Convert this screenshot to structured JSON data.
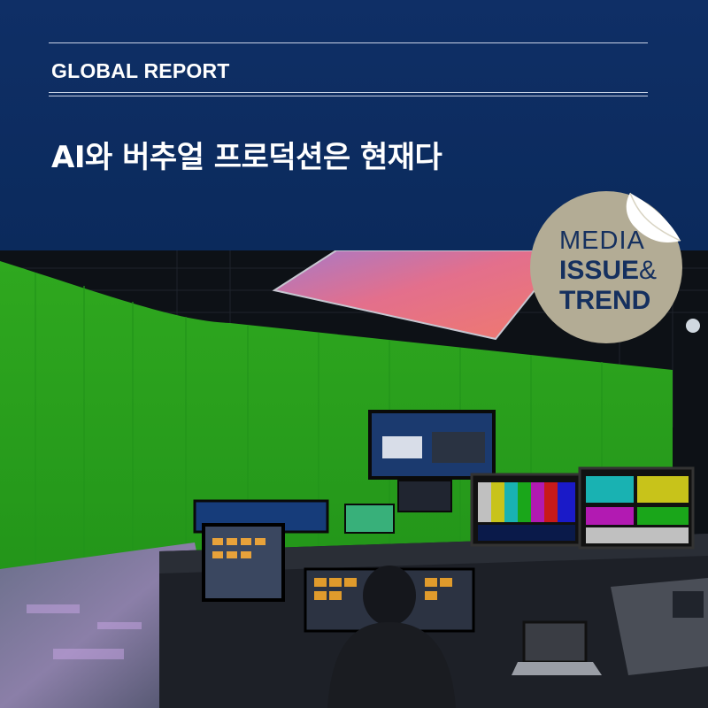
{
  "header": {
    "kicker": "GLOBAL REPORT",
    "headline": "AI와 버추얼 프로덕션은 현재다"
  },
  "badge": {
    "line1": "MEDIA",
    "line2": "ISSUE",
    "line2_suffix": "&",
    "line3": "TREND"
  },
  "colors": {
    "header_navy": "#0b2a5c",
    "badge_beige": "#b3ac95",
    "badge_text": "#15305f",
    "green_screen": "#2fa81f"
  }
}
